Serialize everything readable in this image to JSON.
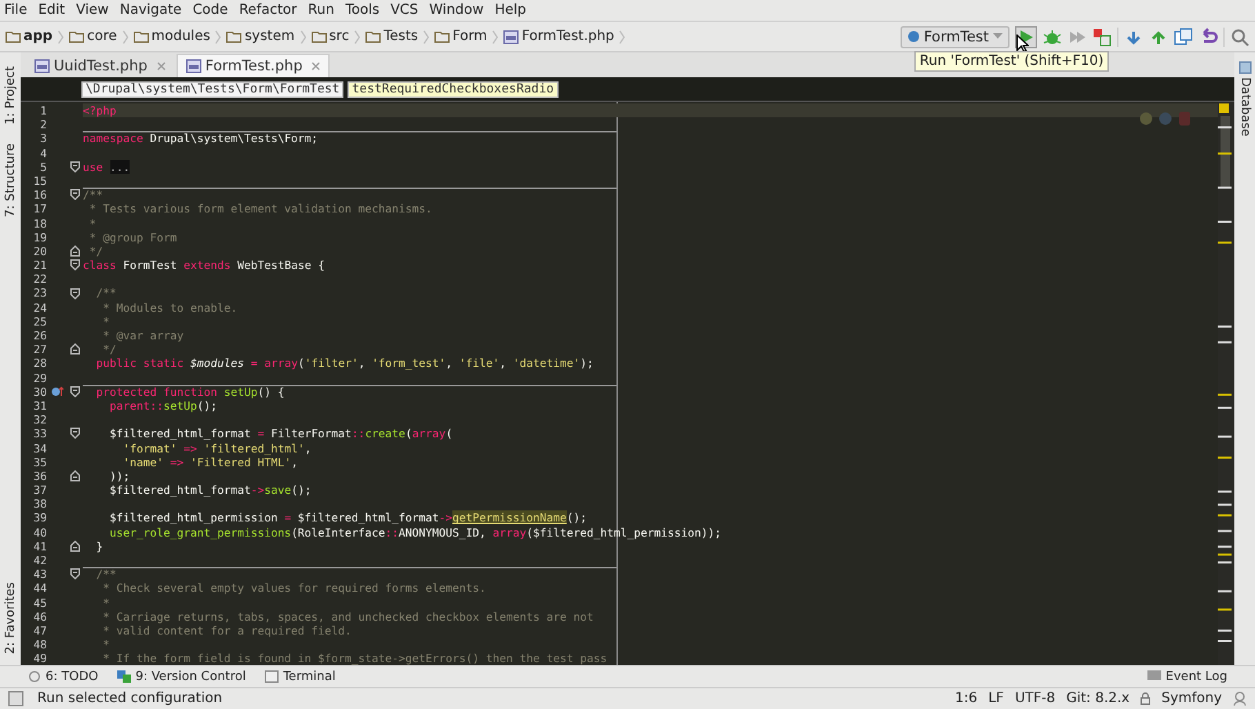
{
  "menu": [
    "File",
    "Edit",
    "View",
    "Navigate",
    "Code",
    "Refactor",
    "Run",
    "Tools",
    "VCS",
    "Window",
    "Help"
  ],
  "breadcrumbs": [
    {
      "label": "app",
      "kind": "root"
    },
    {
      "label": "core",
      "kind": "folder"
    },
    {
      "label": "modules",
      "kind": "folder"
    },
    {
      "label": "system",
      "kind": "folder"
    },
    {
      "label": "src",
      "kind": "folder"
    },
    {
      "label": "Tests",
      "kind": "folder"
    },
    {
      "label": "Form",
      "kind": "folder"
    },
    {
      "label": "FormTest.php",
      "kind": "file"
    }
  ],
  "run_config": "FormTest",
  "tooltip": "Run 'FormTest' (Shift+F10)",
  "left_tools": [
    "1: Project",
    "7: Structure",
    "2: Favorites"
  ],
  "right_tools": [
    "Database"
  ],
  "tabs": [
    {
      "label": "UuidTest.php",
      "selected": false
    },
    {
      "label": "FormTest.php",
      "selected": true
    }
  ],
  "editor_path": [
    {
      "label": "\\Drupal\\system\\Tests\\Form\\FormTest",
      "kind": "class"
    },
    {
      "label": "testRequiredCheckboxesRadio",
      "kind": "method"
    }
  ],
  "lines": [
    {
      "n": "1",
      "kind": "plain",
      "current": true,
      "override": false,
      "tokens": [
        {
          "kind": "tag",
          "text": "<?php"
        }
      ]
    },
    {
      "n": "2",
      "kind": "plain",
      "current": false,
      "override": false
    },
    {
      "n": "3",
      "kind": "plain",
      "current": false,
      "override": false,
      "sep": true,
      "tokens": [
        {
          "kind": "kw",
          "text": "namespace"
        },
        {
          "kind": "p",
          "text": " Drupal\\system\\Tests\\Form;"
        }
      ]
    },
    {
      "n": "4",
      "kind": "plain",
      "current": false,
      "override": false
    },
    {
      "n": "5",
      "kind": "fold-start",
      "current": false,
      "override": false,
      "tokens": [
        {
          "kind": "kw",
          "text": "use "
        },
        {
          "kind": "fold",
          "text": "..."
        }
      ]
    },
    {
      "n": "15",
      "kind": "plain",
      "current": false,
      "override": false
    },
    {
      "n": "16",
      "kind": "fold-start",
      "current": false,
      "override": false,
      "sep": true,
      "tokens": [
        {
          "kind": "cmt",
          "text": "/**"
        }
      ]
    },
    {
      "n": "17",
      "kind": "plain",
      "current": false,
      "override": false,
      "tokens": [
        {
          "kind": "cmt",
          "text": " * Tests various form element validation mechanisms."
        }
      ]
    },
    {
      "n": "18",
      "kind": "plain",
      "current": false,
      "override": false,
      "tokens": [
        {
          "kind": "cmt",
          "text": " *"
        }
      ]
    },
    {
      "n": "19",
      "kind": "plain",
      "current": false,
      "override": false,
      "tokens": [
        {
          "kind": "cmt",
          "text": " * @group Form"
        }
      ]
    },
    {
      "n": "20",
      "kind": "fold-end",
      "current": false,
      "override": false,
      "tokens": [
        {
          "kind": "cmt",
          "text": " */"
        }
      ]
    },
    {
      "n": "21",
      "kind": "fold-start",
      "current": false,
      "override": false,
      "tokens": [
        {
          "kind": "kw",
          "text": "class"
        },
        {
          "kind": "p",
          "text": " FormTest "
        },
        {
          "kind": "kw",
          "text": "extends"
        },
        {
          "kind": "p",
          "text": " WebTestBase {"
        }
      ]
    },
    {
      "n": "22",
      "kind": "plain",
      "current": false,
      "override": false
    },
    {
      "n": "23",
      "kind": "fold-start",
      "current": false,
      "override": false,
      "tokens": [
        {
          "kind": "cmt",
          "text": "  /**"
        }
      ]
    },
    {
      "n": "24",
      "kind": "plain",
      "current": false,
      "override": false,
      "tokens": [
        {
          "kind": "cmt",
          "text": "   * Modules to enable."
        }
      ]
    },
    {
      "n": "25",
      "kind": "plain",
      "current": false,
      "override": false,
      "tokens": [
        {
          "kind": "cmt",
          "text": "   *"
        }
      ]
    },
    {
      "n": "26",
      "kind": "plain",
      "current": false,
      "override": false,
      "tokens": [
        {
          "kind": "cmt",
          "text": "   * @var array"
        }
      ]
    },
    {
      "n": "27",
      "kind": "fold-end",
      "current": false,
      "override": false,
      "tokens": [
        {
          "kind": "cmt",
          "text": "   */"
        }
      ]
    },
    {
      "n": "28",
      "kind": "plain",
      "current": false,
      "override": false,
      "tokens": [
        {
          "kind": "kw",
          "text": "  public static "
        },
        {
          "kind": "var",
          "text": "$modules "
        },
        {
          "kind": "kw",
          "text": "= array"
        },
        {
          "kind": "p",
          "text": "("
        },
        {
          "kind": "str",
          "text": "'filter'"
        },
        {
          "kind": "p",
          "text": ", "
        },
        {
          "kind": "str",
          "text": "'form_test'"
        },
        {
          "kind": "p",
          "text": ", "
        },
        {
          "kind": "str",
          "text": "'file'"
        },
        {
          "kind": "p",
          "text": ", "
        },
        {
          "kind": "str",
          "text": "'datetime'"
        },
        {
          "kind": "p",
          "text": ");"
        }
      ]
    },
    {
      "n": "29",
      "kind": "plain",
      "current": false,
      "override": false
    },
    {
      "n": "30",
      "kind": "fold-start",
      "current": false,
      "override": true,
      "sep": true,
      "tokens": [
        {
          "kind": "kw",
          "text": "  protected function "
        },
        {
          "kind": "fn",
          "text": "setUp"
        },
        {
          "kind": "p",
          "text": "() {"
        }
      ]
    },
    {
      "n": "31",
      "kind": "plain",
      "current": false,
      "override": false,
      "tokens": [
        {
          "kind": "kw",
          "text": "    parent::"
        },
        {
          "kind": "fn",
          "text": "setUp"
        },
        {
          "kind": "p",
          "text": "();"
        }
      ]
    },
    {
      "n": "32",
      "kind": "plain",
      "current": false,
      "override": false
    },
    {
      "n": "33",
      "kind": "fold-start",
      "current": false,
      "override": false,
      "tokens": [
        {
          "kind": "p",
          "text": "    $filtered_html_format "
        },
        {
          "kind": "kw",
          "text": "="
        },
        {
          "kind": "p",
          "text": " FilterFormat"
        },
        {
          "kind": "kw",
          "text": "::"
        },
        {
          "kind": "fn",
          "text": "create"
        },
        {
          "kind": "p",
          "text": "("
        },
        {
          "kind": "kw",
          "text": "array"
        },
        {
          "kind": "p",
          "text": "("
        }
      ]
    },
    {
      "n": "34",
      "kind": "plain",
      "current": false,
      "override": false,
      "tokens": [
        {
          "kind": "str",
          "text": "      'format'"
        },
        {
          "kind": "kw",
          "text": " => "
        },
        {
          "kind": "str",
          "text": "'filtered_html'"
        },
        {
          "kind": "p",
          "text": ","
        }
      ]
    },
    {
      "n": "35",
      "kind": "plain",
      "current": false,
      "override": false,
      "tokens": [
        {
          "kind": "str",
          "text": "      'name'"
        },
        {
          "kind": "kw",
          "text": " => "
        },
        {
          "kind": "str",
          "text": "'Filtered HTML'"
        },
        {
          "kind": "p",
          "text": ","
        }
      ]
    },
    {
      "n": "36",
      "kind": "fold-end",
      "current": false,
      "override": false,
      "tokens": [
        {
          "kind": "p",
          "text": "    ));"
        }
      ]
    },
    {
      "n": "37",
      "kind": "plain",
      "current": false,
      "override": false,
      "tokens": [
        {
          "kind": "p",
          "text": "    $filtered_html_format"
        },
        {
          "kind": "kw",
          "text": "->"
        },
        {
          "kind": "fn",
          "text": "save"
        },
        {
          "kind": "p",
          "text": "();"
        }
      ]
    },
    {
      "n": "38",
      "kind": "plain",
      "current": false,
      "override": false
    },
    {
      "n": "39",
      "kind": "plain",
      "current": false,
      "override": false,
      "tokens": [
        {
          "kind": "p",
          "text": "    $filtered_html_permission "
        },
        {
          "kind": "kw",
          "text": "="
        },
        {
          "kind": "p",
          "text": " $filtered_html_format"
        },
        {
          "kind": "kw",
          "text": "->"
        },
        {
          "kind": "hl",
          "text": "getPermissionName"
        },
        {
          "kind": "p",
          "text": "();"
        }
      ]
    },
    {
      "n": "40",
      "kind": "plain",
      "current": false,
      "override": false,
      "tokens": [
        {
          "kind": "fn",
          "text": "    user_role_grant_permissions"
        },
        {
          "kind": "p",
          "text": "(RoleInterface"
        },
        {
          "kind": "kw",
          "text": "::"
        },
        {
          "kind": "p",
          "text": "ANONYMOUS_ID, "
        },
        {
          "kind": "kw",
          "text": "array"
        },
        {
          "kind": "p",
          "text": "($filtered_html_permission));"
        }
      ]
    },
    {
      "n": "41",
      "kind": "fold-end",
      "current": false,
      "override": false,
      "tokens": [
        {
          "kind": "p",
          "text": "  }"
        }
      ]
    },
    {
      "n": "42",
      "kind": "plain",
      "current": false,
      "override": false
    },
    {
      "n": "43",
      "kind": "fold-start",
      "current": false,
      "override": false,
      "sep": true,
      "tokens": [
        {
          "kind": "cmt",
          "text": "  /**"
        }
      ]
    },
    {
      "n": "44",
      "kind": "plain",
      "current": false,
      "override": false,
      "tokens": [
        {
          "kind": "cmt",
          "text": "   * Check several empty values for required forms elements."
        }
      ]
    },
    {
      "n": "45",
      "kind": "plain",
      "current": false,
      "override": false,
      "tokens": [
        {
          "kind": "cmt",
          "text": "   *"
        }
      ]
    },
    {
      "n": "46",
      "kind": "plain",
      "current": false,
      "override": false,
      "tokens": [
        {
          "kind": "cmt",
          "text": "   * Carriage returns, tabs, spaces, and unchecked checkbox elements are not"
        }
      ]
    },
    {
      "n": "47",
      "kind": "plain",
      "current": false,
      "override": false,
      "tokens": [
        {
          "kind": "cmt",
          "text": "   * valid content for a required field."
        }
      ]
    },
    {
      "n": "48",
      "kind": "plain",
      "current": false,
      "override": false,
      "tokens": [
        {
          "kind": "cmt",
          "text": "   *"
        }
      ]
    },
    {
      "n": "49",
      "kind": "plain",
      "current": false,
      "override": false,
      "tokens": [
        {
          "kind": "cmt",
          "text": "   * If the form field is found in $form_state->getErrors() then the test pass"
        }
      ]
    }
  ],
  "bottom_tools": [
    {
      "label": "6: TODO",
      "kind": "todo"
    },
    {
      "label": "9: Version Control",
      "kind": "vcs"
    },
    {
      "label": "Terminal",
      "kind": "terminal"
    }
  ],
  "event_log": "Event Log",
  "status": {
    "message": "Run selected configuration",
    "position": "1:6",
    "line_sep": "LF",
    "encoding": "UTF-8",
    "vcs": "Git: 8.2.x",
    "framework": "Symfony"
  }
}
